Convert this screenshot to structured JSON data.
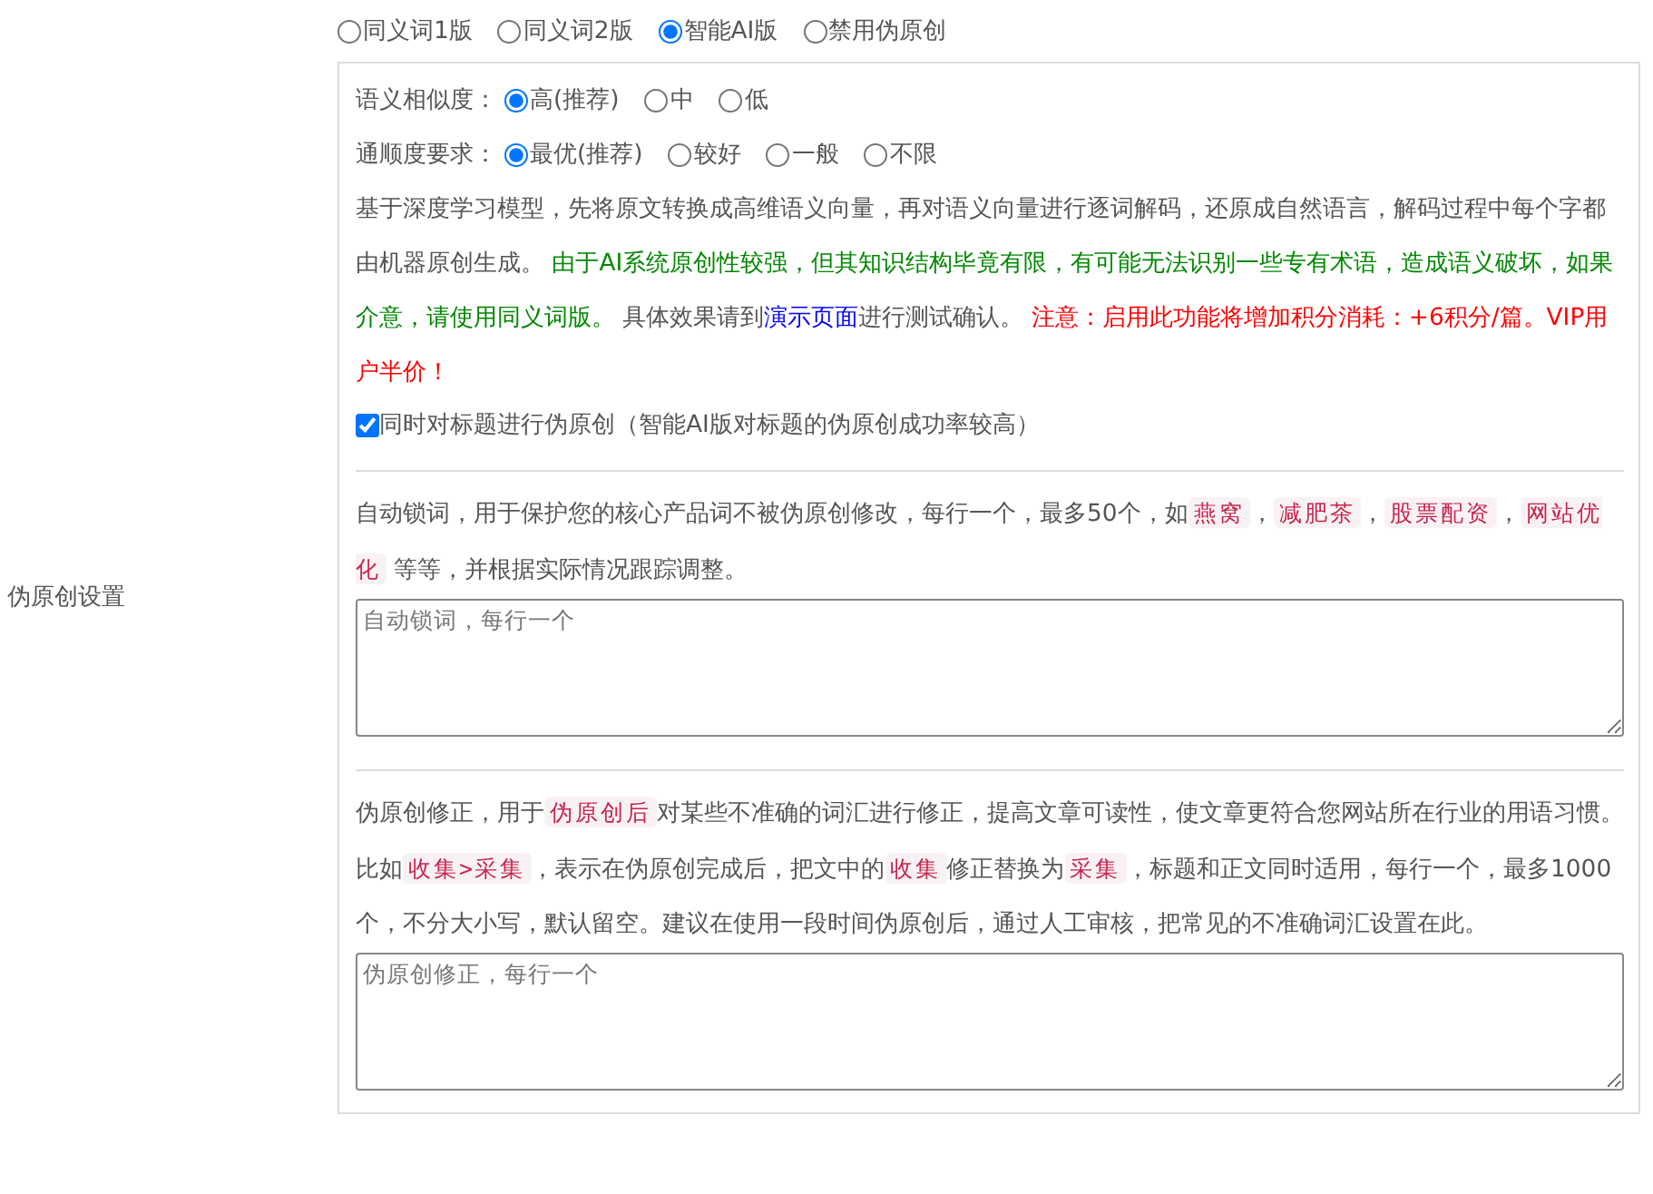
{
  "side_label": "伪原创设置",
  "modes": [
    {
      "label": "同义词1版",
      "selected": false
    },
    {
      "label": "同义词2版",
      "selected": false
    },
    {
      "label": "智能AI版",
      "selected": true
    },
    {
      "label": "禁用伪原创",
      "selected": false
    }
  ],
  "similarity": {
    "label": "语义相似度：",
    "options": [
      {
        "label": "高(推荐)",
        "selected": true
      },
      {
        "label": "中",
        "selected": false
      },
      {
        "label": "低",
        "selected": false
      }
    ]
  },
  "fluency": {
    "label": "通顺度要求：",
    "options": [
      {
        "label": "最优(推荐)",
        "selected": true
      },
      {
        "label": "较好",
        "selected": false
      },
      {
        "label": "一般",
        "selected": false
      },
      {
        "label": "不限",
        "selected": false
      }
    ]
  },
  "ai_description": [
    {
      "kind": "plain",
      "text": "基于深度学习模型，先将原文转换成高维语义向量，再对语义向量进行逐词解码，还原成自然语言，解码过程中每个字都由机器原创生成。 "
    },
    {
      "kind": "green",
      "text": "由于AI系统原创性较强，但其知识结构毕竟有限，有可能无法识别一些专有术语，造成语义破坏，如果介意，请使用同义词版。"
    },
    {
      "kind": "plain",
      "text": " 具体效果请到"
    },
    {
      "kind": "link",
      "text": "演示页面"
    },
    {
      "kind": "plain",
      "text": "进行测试确认。 "
    },
    {
      "kind": "red",
      "text": "注意：启用此功能将增加积分消耗：+6积分/篇。VIP用户半价！"
    }
  ],
  "title_option": {
    "label": "同时对标题进行伪原创（智能AI版对标题的伪原创成功率较高）",
    "checked": true
  },
  "lock_words": {
    "description": [
      {
        "kind": "plain",
        "text": "自动锁词，用于保护您的核心产品词不被伪原创修改，每行一个，最多50个，如"
      },
      {
        "kind": "code",
        "text": "燕窝"
      },
      {
        "kind": "plain",
        "text": "，"
      },
      {
        "kind": "code",
        "text": "减肥茶"
      },
      {
        "kind": "plain",
        "text": "，"
      },
      {
        "kind": "code",
        "text": "股票配资"
      },
      {
        "kind": "plain",
        "text": "，"
      },
      {
        "kind": "code",
        "text": "网站优化"
      },
      {
        "kind": "plain",
        "text": " 等等，并根据实际情况跟踪调整。"
      }
    ],
    "placeholder": "自动锁词，每行一个"
  },
  "corrections": {
    "description": [
      {
        "kind": "plain",
        "text": "伪原创修正，用于"
      },
      {
        "kind": "code",
        "text": "伪原创后"
      },
      {
        "kind": "plain",
        "text": "对某些不准确的词汇进行修正，提高文章可读性，使文章更符合您网站所在行业的用语习惯。比如"
      },
      {
        "kind": "code",
        "text": "收集>采集"
      },
      {
        "kind": "plain",
        "text": "，表示在伪原创完成后，把文中的"
      },
      {
        "kind": "code",
        "text": "收集"
      },
      {
        "kind": "plain",
        "text": "修正替换为"
      },
      {
        "kind": "code",
        "text": "采集"
      },
      {
        "kind": "plain",
        "text": "，标题和正文同时适用，每行一个，最多1000个，不分大小写，默认留空。建议在使用一段时间伪原创后，通过人工审核，把常见的不准确词汇设置在此。"
      }
    ],
    "placeholder": "伪原创修正，每行一个"
  }
}
